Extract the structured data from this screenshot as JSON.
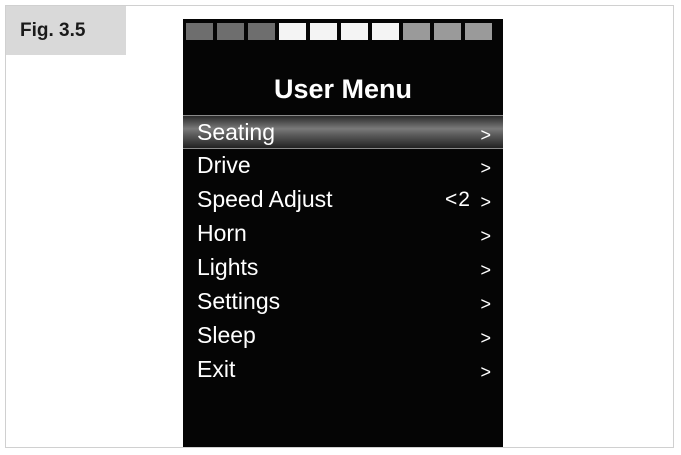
{
  "figure": {
    "label": "Fig. 3.5"
  },
  "battery": {
    "segments": [
      "dark",
      "dark",
      "dark",
      "lit",
      "lit",
      "lit",
      "lit",
      "dim",
      "dim",
      "dim"
    ]
  },
  "menu": {
    "title": "User Menu",
    "items": [
      {
        "label": "Seating",
        "value": "",
        "arrow": ">",
        "selected": true
      },
      {
        "label": "Drive",
        "value": "",
        "arrow": ">",
        "selected": false
      },
      {
        "label": "Speed Adjust",
        "value": "<2",
        "arrow": ">",
        "selected": false
      },
      {
        "label": "Horn",
        "value": "",
        "arrow": ">",
        "selected": false
      },
      {
        "label": "Lights",
        "value": "",
        "arrow": ">",
        "selected": false
      },
      {
        "label": "Settings",
        "value": "",
        "arrow": ">",
        "selected": false
      },
      {
        "label": "Sleep",
        "value": "",
        "arrow": ">",
        "selected": false
      },
      {
        "label": "Exit",
        "value": "",
        "arrow": ">",
        "selected": false
      }
    ]
  }
}
